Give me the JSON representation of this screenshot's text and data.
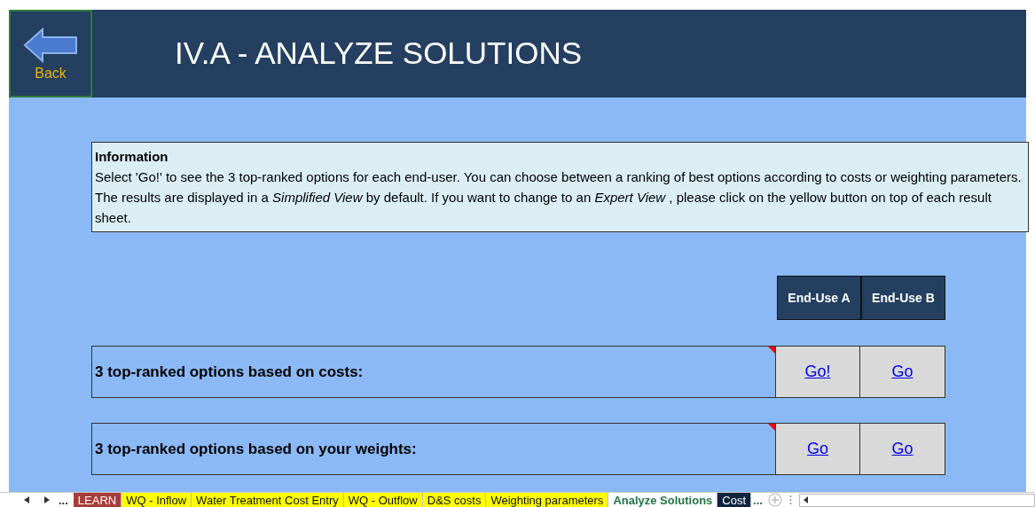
{
  "back_button": {
    "label": "Back"
  },
  "title": "IV.A - ANALYZE SOLUTIONS",
  "information": {
    "heading": "Information",
    "text": "Select 'Go!' to see the 3 top-ranked options for each end-user. You can choose between a ranking of best options according to costs or weighting parameters. The results are displayed in a *Simplified View*  by default. If you want to change to an *Expert View* , please click on the yellow button on top of each result sheet."
  },
  "columns": [
    "End-Use A",
    "End-Use B"
  ],
  "rows": [
    {
      "label": "3 top-ranked options based on costs:",
      "has_comment": true,
      "links": [
        "Go!",
        "Go"
      ]
    },
    {
      "label": "3 top-ranked options based on your weights:",
      "has_comment": true,
      "links": [
        "Go",
        "Go"
      ]
    }
  ],
  "tab_bar": {
    "more_left": "...",
    "more_right": "...",
    "tabs": [
      {
        "label": "LEARN",
        "color": "#a93c3a",
        "selected": false
      },
      {
        "label": "WQ - Inflow",
        "color": "#ffff00",
        "selected": false
      },
      {
        "label": "Water Treatment Cost Entry",
        "color": "#ffff00",
        "selected": false
      },
      {
        "label": "WQ - Outflow",
        "color": "#ffff00",
        "selected": false
      },
      {
        "label": "D&S costs",
        "color": "#ffff00",
        "selected": false
      },
      {
        "label": "Weighting parameters",
        "color": "#ffff00",
        "selected": false
      },
      {
        "label": "Analyze Solutions",
        "selected": true
      },
      {
        "label": "Cost",
        "color": "#0f243e",
        "selected": false
      }
    ]
  }
}
